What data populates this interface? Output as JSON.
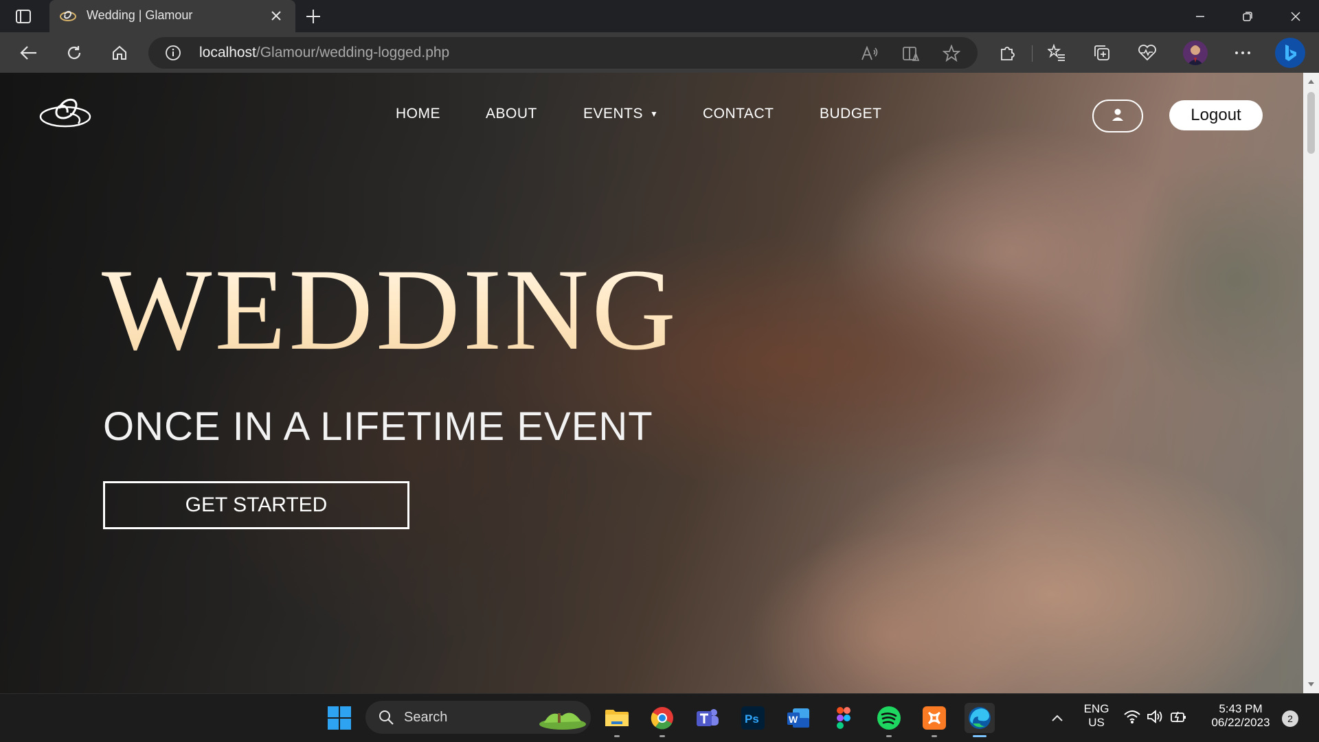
{
  "browser": {
    "tab_title": "Wedding | Glamour",
    "url_host": "localhost",
    "url_path": "/Glamour/wedding-logged.php"
  },
  "nav": {
    "home": "HOME",
    "about": "ABOUT",
    "events": "EVENTS",
    "contact": "CONTACT",
    "budget": "BUDGET",
    "logout": "Logout"
  },
  "hero": {
    "title": "WEDDING",
    "subtitle": "ONCE IN A LIFETIME EVENT",
    "cta": "GET STARTED"
  },
  "taskbar": {
    "search_label": "Search",
    "lang_line1": "ENG",
    "lang_line2": "US",
    "time": "5:43 PM",
    "date": "06/22/2023",
    "notification_count": "2"
  },
  "icons": {
    "tab_actions": "tab-actions-icon",
    "favicon": "glamour-logo-icon",
    "close_tab": "close-icon",
    "new_tab": "plus-icon",
    "minimize": "minimize-icon",
    "restore": "restore-icon",
    "close_window": "close-icon",
    "back": "back-arrow-icon",
    "refresh": "refresh-icon",
    "home": "home-icon",
    "site_info": "info-icon",
    "read_aloud": "read-aloud-icon",
    "immersive_reader": "immersive-reader-icon",
    "favorite": "star-icon",
    "extensions": "puzzle-icon",
    "favorites": "favorites-list-icon",
    "collections": "collections-icon",
    "performance": "heart-pulse-icon",
    "profile": "avatar",
    "more": "ellipsis-icon",
    "bing": "bing-icon",
    "user": "user-icon"
  },
  "colors": {
    "brand_title_gradient_top": "#fff6e6",
    "brand_title_gradient_bottom": "#f6d7a8",
    "edge_accent": "#7cc4ff"
  }
}
